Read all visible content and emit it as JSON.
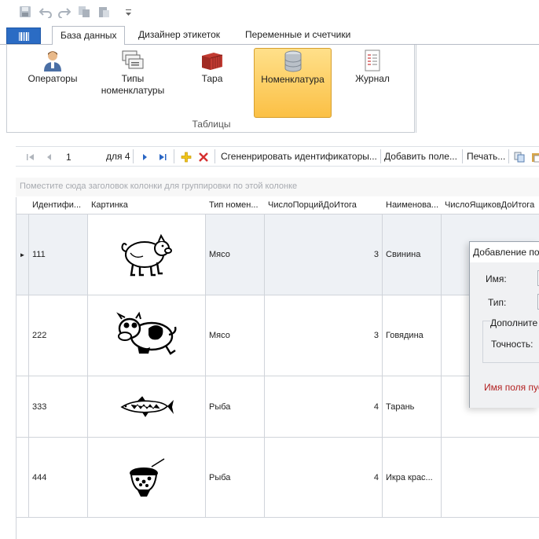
{
  "tabs": [
    "База данных",
    "Дизайнер этикеток",
    "Переменные и счетчики"
  ],
  "ribbon": {
    "buttons": [
      {
        "label": "Операторы",
        "icon": "user-icon"
      },
      {
        "label": "Типы\nноменклатуры",
        "icon": "cards-icon"
      },
      {
        "label": "Тара",
        "icon": "container-icon"
      },
      {
        "label": "Номенклатура",
        "icon": "database-icon"
      },
      {
        "label": "Журнал",
        "icon": "journal-icon"
      }
    ],
    "group_label": "Таблицы"
  },
  "navigator": {
    "position": "1",
    "of_label": "для 4",
    "generate_label": "Сгененрировать идентификаторы...",
    "add_field_label": "Добавить поле...",
    "print_label": "Печать..."
  },
  "group_panel_hint": "Поместите сюда заголовок колонки для группировки по этой колонке",
  "grid": {
    "columns": [
      "Идентифи...",
      "Картинка",
      "Тип номен...",
      "ЧислоПорцийДоИтога",
      "Наименова...",
      "ЧислоЯщиковДоИтога"
    ],
    "rows": [
      {
        "id": "111",
        "picture": "pig-icon",
        "type": "Мясо",
        "portions": "3",
        "name": "Свинина",
        "selected": true
      },
      {
        "id": "222",
        "picture": "cow-icon",
        "type": "Мясо",
        "portions": "3",
        "name": "Говядина",
        "selected": false
      },
      {
        "id": "333",
        "picture": "fish-icon",
        "type": "Рыба",
        "portions": "4",
        "name": "Тарань",
        "selected": false
      },
      {
        "id": "444",
        "picture": "caviar-icon",
        "type": "Рыба",
        "portions": "4",
        "name": "Икра крас...",
        "selected": false
      }
    ]
  },
  "dialog": {
    "title": "Добавление по",
    "name_label": "Имя:",
    "type_label": "Тип:",
    "extra_label": "Дополните",
    "precision_label": "Точность:",
    "error": "Имя поля пус"
  }
}
